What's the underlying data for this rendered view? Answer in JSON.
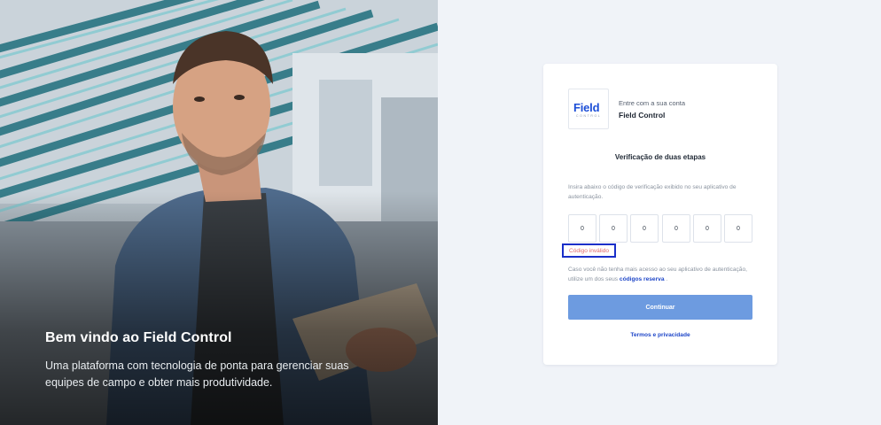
{
  "hero": {
    "title": "Bem vindo ao Field Control",
    "subtitle": "Uma plataforma com tecnologia de ponta para gerenciar suas equipes de campo e obter mais produtividade."
  },
  "brand": {
    "logo_text": "Field",
    "logo_subtext": "CONTROL",
    "caption": "Entre com a sua conta",
    "name": "Field Control"
  },
  "verification": {
    "title": "Verificação de duas etapas",
    "instructions": "Insira abaixo o código de verificação exibido no seu aplicativo de autenticação.",
    "digits": [
      "0",
      "0",
      "0",
      "0",
      "0",
      "0"
    ],
    "error": "Código inválido",
    "help_prefix": "Caso você não tenha mais acesso ao seu aplicativo de autenticação, utilize um dos seus",
    "help_link": "códigos reserva",
    "help_suffix": ".",
    "continue_label": "Continuar",
    "terms_label": "Termos e privacidade"
  },
  "colors": {
    "accent": "#1f47c8",
    "button": "#6d9be0",
    "error": "#e26b6b",
    "background": "#f0f3f8"
  }
}
